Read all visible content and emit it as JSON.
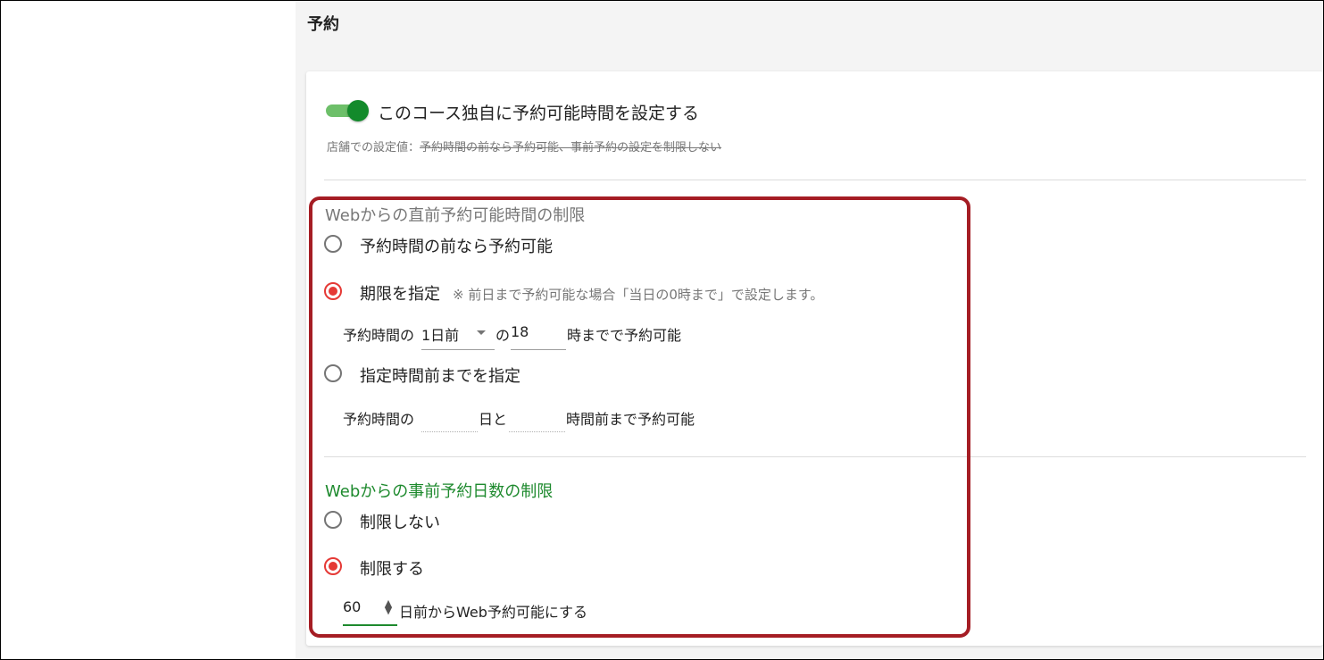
{
  "section": {
    "title": "予約"
  },
  "toggle": {
    "label": "このコース独自に予約可能時間を設定する",
    "checked": true
  },
  "store_setting": {
    "prefix": "店舗での設定値：",
    "value": "予約時間の前なら予約可能、事前予約の設定を制限しない"
  },
  "direct_limit": {
    "title": "Webからの直前予約可能時間の制限",
    "option1": {
      "label": "予約時間の前なら予約可能",
      "checked": false
    },
    "option2": {
      "label": "期限を指定",
      "hint": "※ 前日まで予約可能な場合「当日の0時まで」で設定します。",
      "checked": true,
      "prefix": "予約時間の",
      "day_select": "1日前",
      "mid": "の",
      "hour_value": "18",
      "suffix": "時までで予約可能"
    },
    "option3": {
      "label": "指定時間前までを指定",
      "checked": false,
      "prefix": "予約時間の",
      "days_value": "",
      "days_unit": "日と",
      "hours_value": "",
      "suffix": "時間前まで予約可能"
    }
  },
  "advance_limit": {
    "title": "Webからの事前予約日数の制限",
    "option1": {
      "label": "制限しない",
      "checked": false
    },
    "option2": {
      "label": "制限する",
      "checked": true
    },
    "days_value": "60",
    "suffix": "日前からWeb予約可能にする"
  },
  "colors": {
    "accent_green": "#1e8a2e",
    "toggle_track": "#6dbf69",
    "radio_checked": "#e53935",
    "highlight": "#a51d24"
  }
}
